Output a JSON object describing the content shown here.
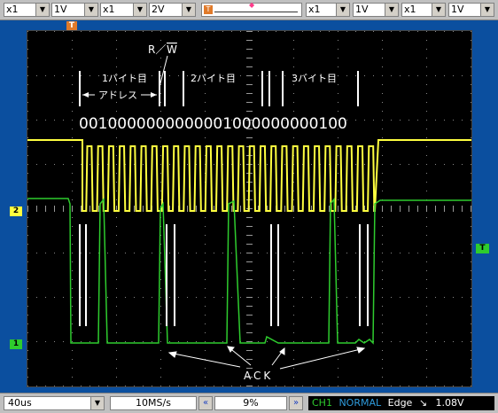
{
  "toolbar": {
    "ch1_probe": "x1",
    "ch1_volts": "1V",
    "ch2_probe": "x1",
    "ch2_volts": "2V",
    "trigger_icon": "T",
    "ch3_probe": "x1",
    "ch3_volts": "1V",
    "ch4_probe": "x1",
    "ch4_volts": "1V"
  },
  "markers": {
    "trigger_top": "T",
    "ch2_level": "2",
    "ch1_level": "1",
    "trigger_level": "T"
  },
  "annotations": {
    "rw_r": "R／",
    "rw_w": "W",
    "byte1": "1バイト目",
    "byte2": "2バイト目",
    "byte3": "3バイト目",
    "address": "アドレス",
    "bits": "0010000000000001000000000100",
    "ack": "ACK"
  },
  "status": {
    "timebase": "40us",
    "sample_rate": "10MS/s",
    "position": "9%",
    "channel": "CH1",
    "mode": "NORMAL",
    "trigger_type": "Edge",
    "trigger_slope_icon": "falling-edge-icon",
    "trigger_level": "1.08V"
  },
  "colors": {
    "sda": "#ffff40",
    "scl": "#2ecc2e",
    "background": "#0b4f9f",
    "grid": "#7a7a7a"
  }
}
